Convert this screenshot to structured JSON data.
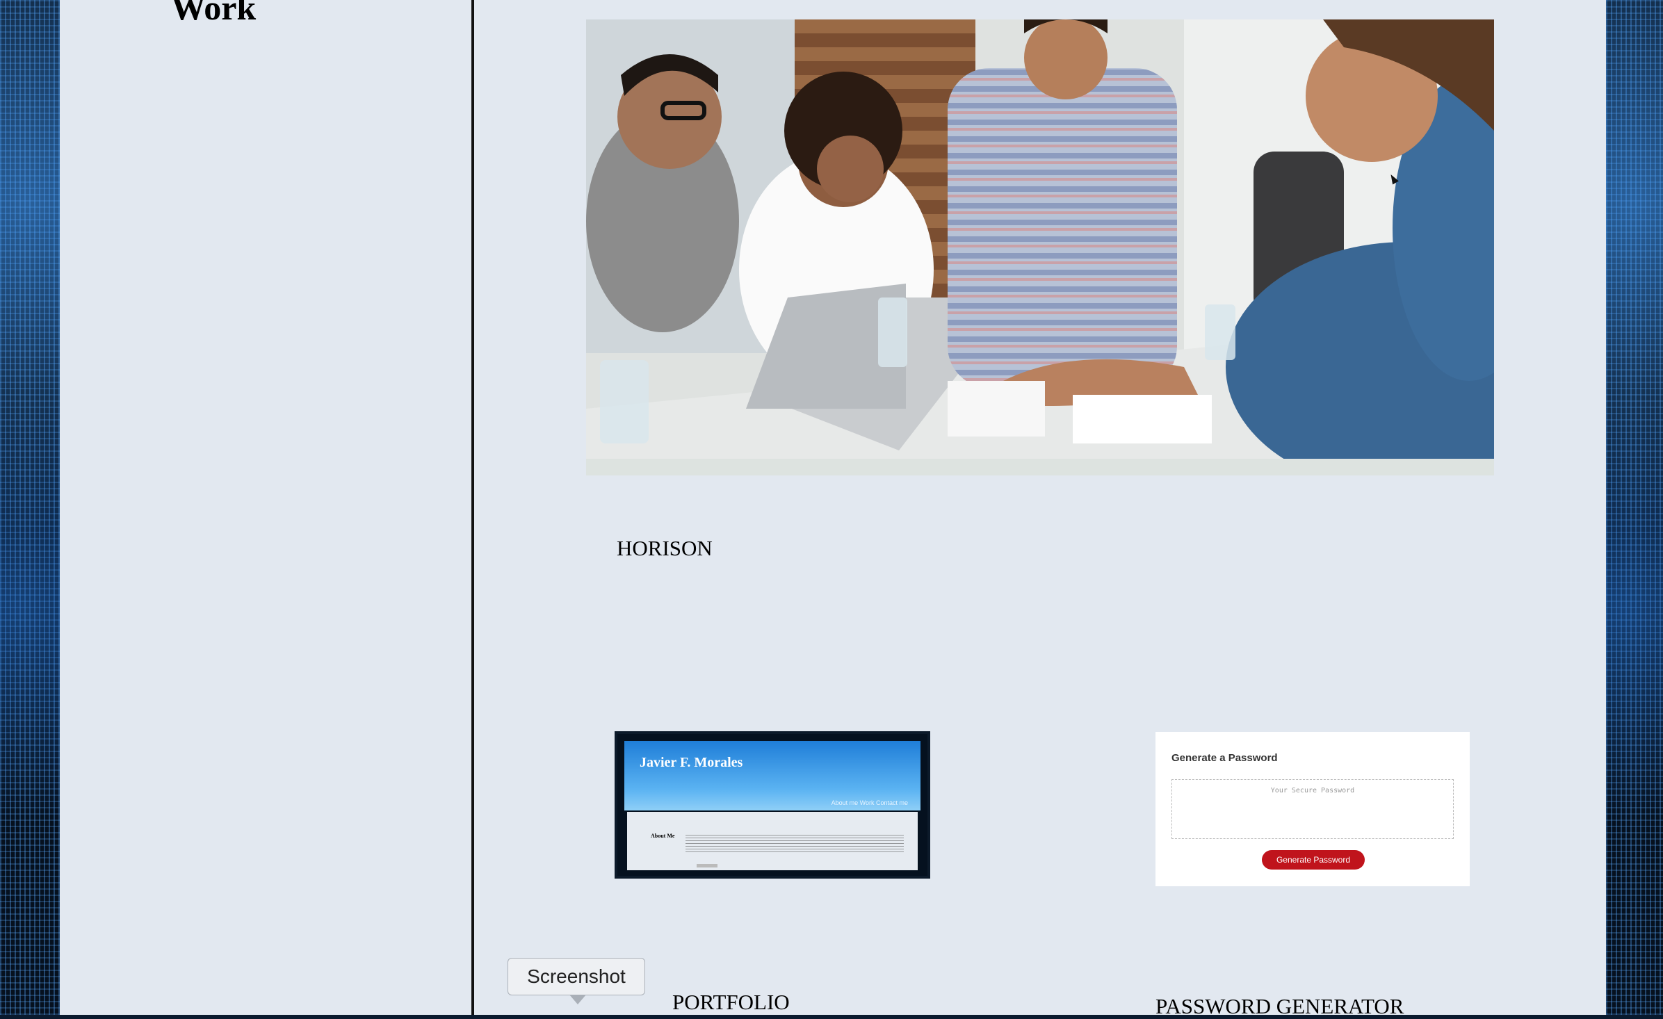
{
  "sidebar": {
    "heading": "Work"
  },
  "hero": {
    "image": "team-meeting-photo"
  },
  "projects": [
    {
      "title": "HORISON"
    },
    {
      "title": "PORTFOLIO",
      "thumbnail": {
        "name": "Javier F. Morales",
        "nav": "About me   Work   Contact me",
        "about": "About Me"
      }
    },
    {
      "title": "PASSWORD GENERATOR",
      "thumbnail": {
        "heading": "Generate a Password",
        "placeholder": "Your Secure Password",
        "button": "Generate Password"
      }
    }
  ],
  "tooltip": {
    "label": "Screenshot"
  },
  "colors": {
    "page_bg": "#e2e8f0",
    "divider": "#111111",
    "generate_button": "#c0141c",
    "matrix_blue": "#1f7ed8"
  }
}
